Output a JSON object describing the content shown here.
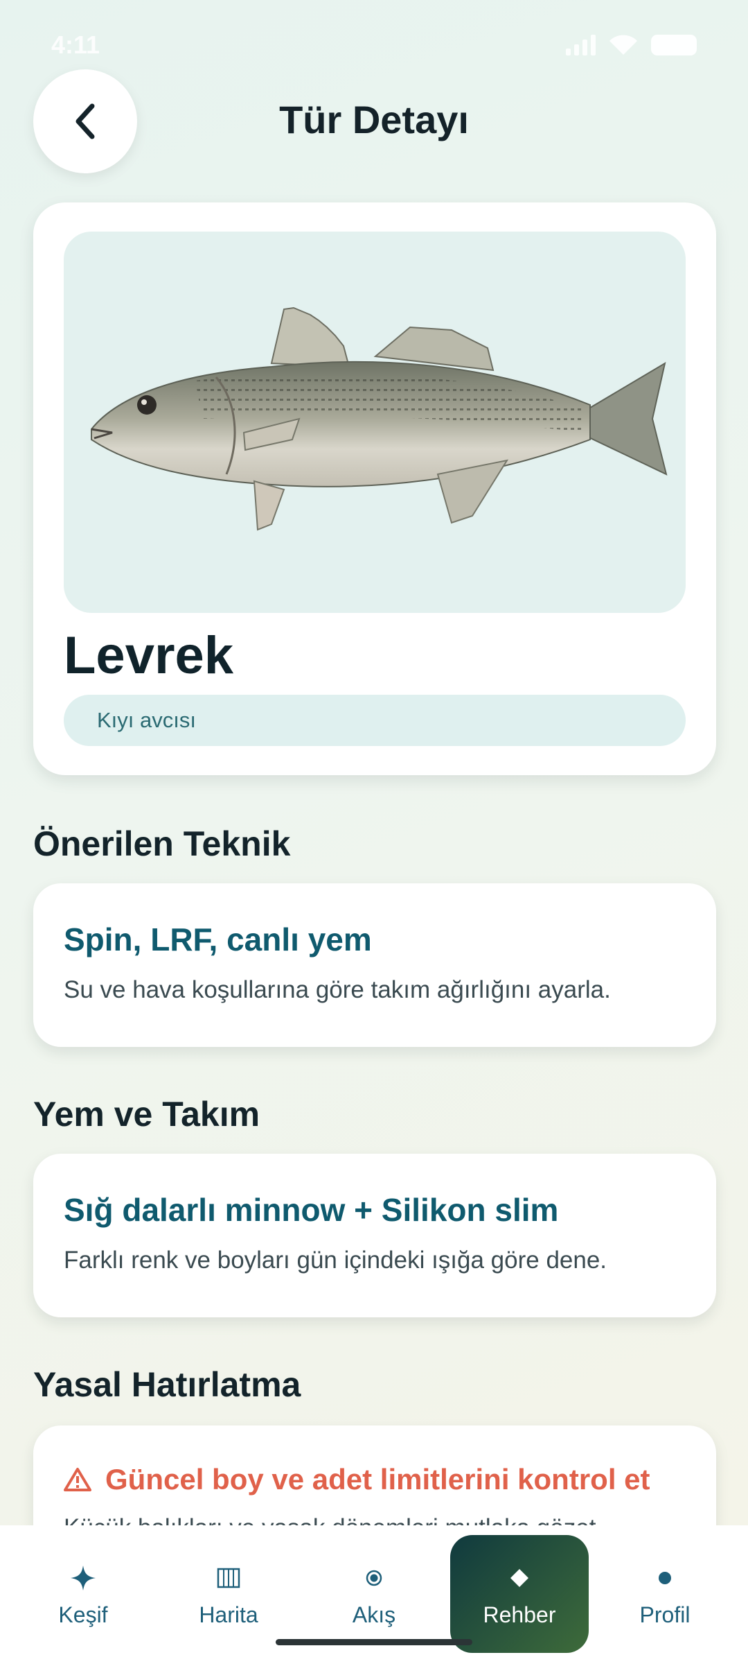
{
  "status_bar": {
    "time": "4:11"
  },
  "header": {
    "title": "Tür Detayı"
  },
  "species": {
    "name": "Levrek",
    "tag": "Kıyı avcısı"
  },
  "sections": {
    "technique": {
      "heading": "Önerilen Teknik",
      "title": "Spin, LRF, canlı yem",
      "description": "Su ve hava koşullarına göre takım ağırlığını ayarla."
    },
    "bait": {
      "heading": "Yem ve Takım",
      "title": "Sığ dalarlı minnow + Silikon slim",
      "description": "Farklı renk ve boyları gün içindeki ışığa göre dene."
    },
    "legal": {
      "heading": "Yasal Hatırlatma",
      "title": "Güncel boy ve adet limitlerini kontrol et",
      "description": "Küçük balıkları ve yasak dönemleri mutlaka gözet."
    }
  },
  "bottom_nav": {
    "items": [
      {
        "label": "Keşif",
        "icon": "sparkle-icon"
      },
      {
        "label": "Harita",
        "icon": "map-grid-icon"
      },
      {
        "label": "Akış",
        "icon": "target-dot-icon"
      },
      {
        "label": "Rehber",
        "icon": "diamond-icon",
        "active": true
      },
      {
        "label": "Profil",
        "icon": "dot-icon"
      }
    ]
  },
  "colors": {
    "accent": "#0f5a6e",
    "warning": "#e0614a",
    "active_nav_start": "#103a3e",
    "active_nav_end": "#3e6b3a"
  }
}
